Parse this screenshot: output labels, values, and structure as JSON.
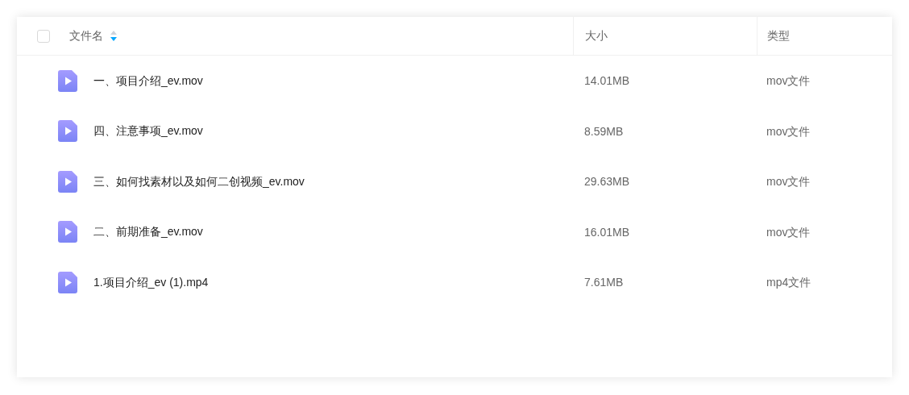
{
  "table": {
    "select_all": {
      "checked": false
    },
    "columns": [
      {
        "label": "文件名",
        "sort_ascending": false,
        "sort_descending": true
      },
      {
        "label": "大小"
      },
      {
        "label": "类型"
      }
    ],
    "rows": [
      {
        "name": "一、项目介绍_ev.mov",
        "size": "14.01MB",
        "type": "mov文件"
      },
      {
        "name": "四、注意事项_ev.mov",
        "size": "8.59MB",
        "type": "mov文件"
      },
      {
        "name": "三、如何找素材以及如何二创视频_ev.mov",
        "size": "29.63MB",
        "type": "mov文件"
      },
      {
        "name": "二、前期准备_ev.mov",
        "size": "16.01MB",
        "type": "mov文件"
      },
      {
        "name": "1.项目介绍_ev (1).mp4",
        "size": "7.61MB",
        "type": "mp4文件"
      }
    ]
  }
}
